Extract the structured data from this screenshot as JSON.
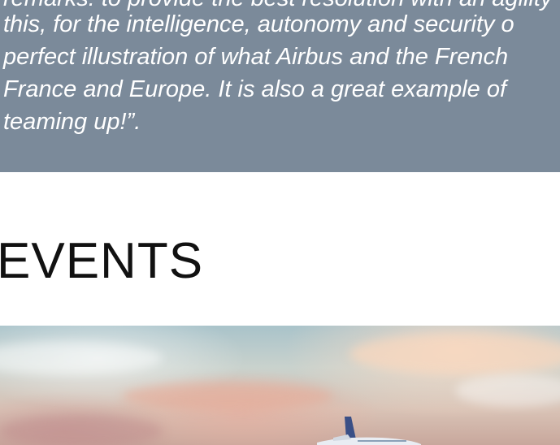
{
  "quote": {
    "lines": [
      "remarks: to provide the best resolution with an agility",
      "this, for the intelligence, autonomy and security o",
      "perfect illustration of what Airbus and the French",
      "France and Europe. It is also a great example of",
      "teaming up!”."
    ]
  },
  "events": {
    "title": "EVENTS"
  },
  "hero_image": {
    "description_icon": "aircraft-icon"
  },
  "colors": {
    "quote_background": "#7b8a9a",
    "quote_text": "#ffffff",
    "title_text": "#111111"
  }
}
